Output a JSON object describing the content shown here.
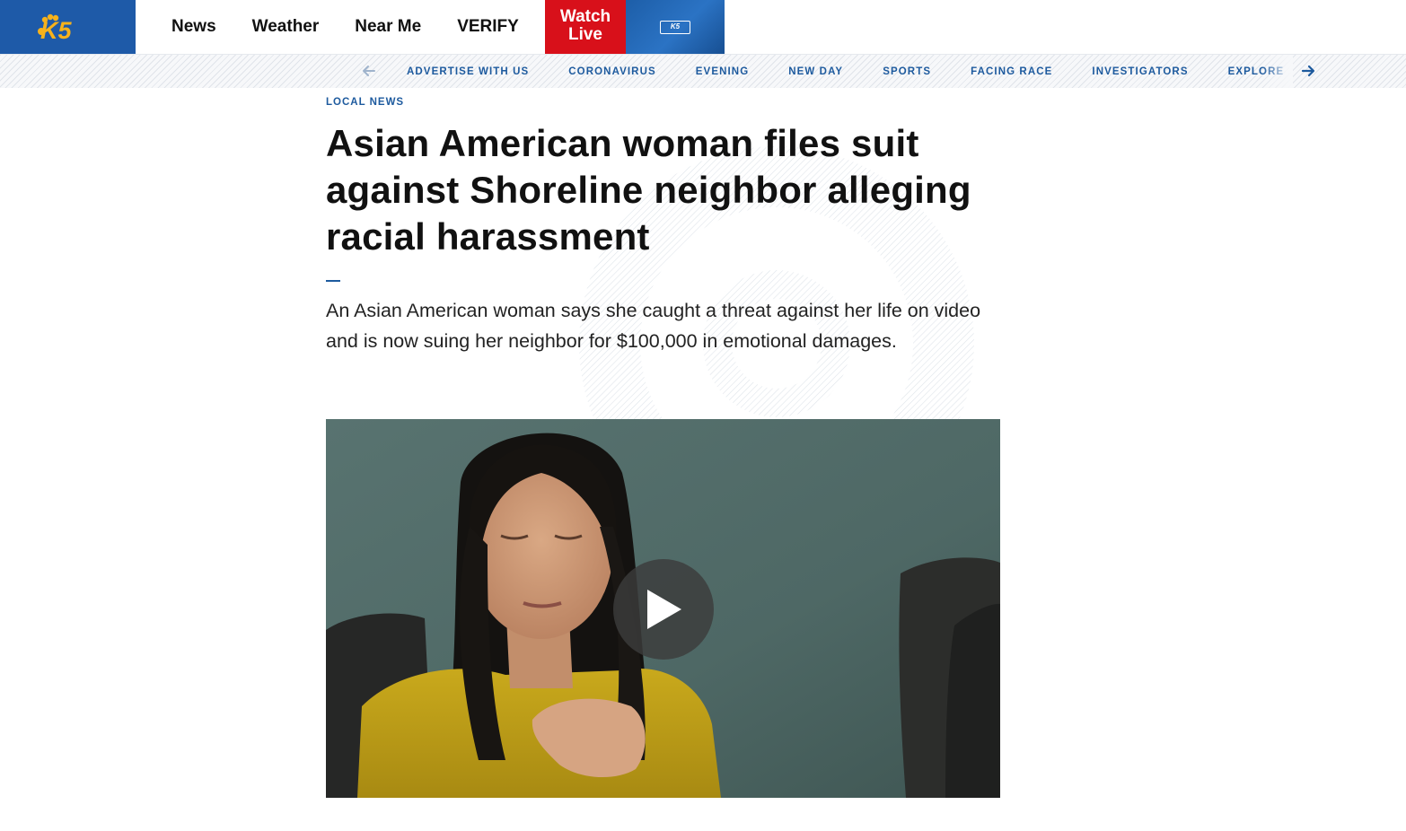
{
  "brand": {
    "logo_text": "K5",
    "accent": "#1e5aa8",
    "live_red": "#d8101a",
    "link_blue": "#1d5a9e"
  },
  "primary_nav": [
    {
      "label": "News"
    },
    {
      "label": "Weather"
    },
    {
      "label": "Near Me"
    },
    {
      "label": "VERIFY"
    }
  ],
  "watch_live": {
    "line1": "Watch",
    "line2": "Live"
  },
  "live_thumbnail": {
    "badge": "K5"
  },
  "secondary_nav": {
    "prev_icon": "arrow-left-icon",
    "next_icon": "arrow-right-icon",
    "items": [
      {
        "label": "ADVERTISE WITH US"
      },
      {
        "label": "CORONAVIRUS"
      },
      {
        "label": "EVENING"
      },
      {
        "label": "NEW DAY"
      },
      {
        "label": "SPORTS"
      },
      {
        "label": "FACING RACE"
      },
      {
        "label": "INVESTIGATORS"
      },
      {
        "label": "EXPLORE"
      }
    ]
  },
  "article": {
    "category": "LOCAL NEWS",
    "headline": "Asian American woman files suit against Shoreline neighbor alleging racial harassment",
    "summary": "An Asian American woman says she caught a threat against her life on video and is now suing her neighbor for $100,000 in emotional damages."
  },
  "video": {
    "play_icon": "play-icon"
  }
}
